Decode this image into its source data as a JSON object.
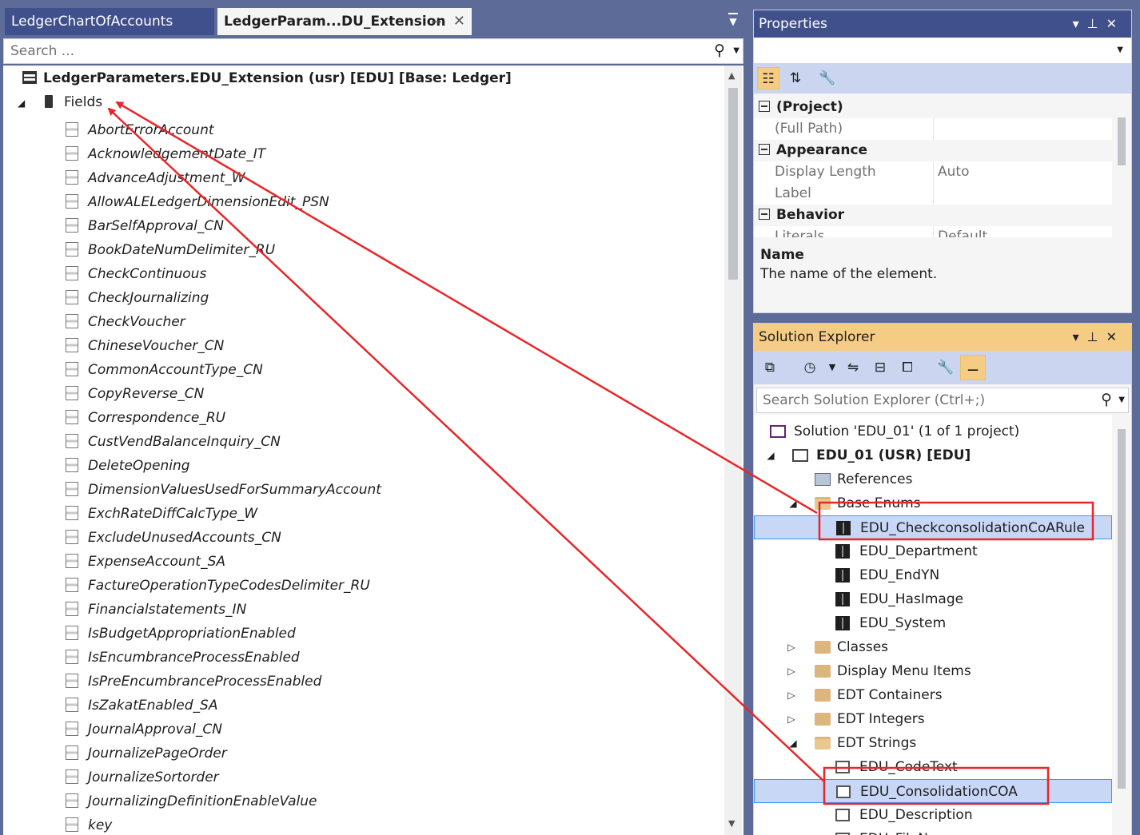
{
  "editor": {
    "tabs": [
      {
        "label": "LedgerChartOfAccounts",
        "active": false
      },
      {
        "label": "LedgerParam...DU_Extension",
        "active": true
      }
    ],
    "search_placeholder": "Search ...",
    "root_label": "LedgerParameters.EDU_Extension (usr) [EDU] [Base: Ledger]",
    "fields_label": "Fields",
    "fields": [
      "AbortErrorAccount",
      "AcknowledgementDate_IT",
      "AdvanceAdjustment_W",
      "AllowALELedgerDimensionEdit_PSN",
      "BarSelfApproval_CN",
      "BookDateNumDelimiter_RU",
      "CheckContinuous",
      "CheckJournalizing",
      "CheckVoucher",
      "ChineseVoucher_CN",
      "CommonAccountType_CN",
      "CopyReverse_CN",
      "Correspondence_RU",
      "CustVendBalanceInquiry_CN",
      "DeleteOpening",
      "DimensionValuesUsedForSummaryAccount",
      "ExchRateDiffCalcType_W",
      "ExcludeUnusedAccounts_CN",
      "ExpenseAccount_SA",
      "FactureOperationTypeCodesDelimiter_RU",
      "Financialstatements_IN",
      "IsBudgetAppropriationEnabled",
      "IsEncumbranceProcessEnabled",
      "IsPreEncumbranceProcessEnabled",
      "IsZakatEnabled_SA",
      "JournalApproval_CN",
      "JournalizePageOrder",
      "JournalizeSortorder",
      "JournalizingDefinitionEnableValue",
      "key"
    ]
  },
  "properties": {
    "title": "Properties",
    "categories": [
      {
        "name": "(Project)",
        "rows": [
          {
            "name": "(Full Path)",
            "value": ""
          }
        ]
      },
      {
        "name": "Appearance",
        "rows": [
          {
            "name": "Display Length",
            "value": "Auto"
          },
          {
            "name": "Label",
            "value": ""
          }
        ]
      },
      {
        "name": "Behavior",
        "rows": [
          {
            "name": "Literals",
            "value": "Default"
          }
        ]
      }
    ],
    "description_name": "Name",
    "description_text": "The name of the element."
  },
  "solution_explorer": {
    "title": "Solution Explorer",
    "search_placeholder": "Search Solution Explorer (Ctrl+;)",
    "solution_label": "Solution 'EDU_01' (1 of 1 project)",
    "project_label": "EDU_01 (USR) [EDU]",
    "references_label": "References",
    "base_enums_label": "Base Enums",
    "base_enums": [
      "EDU_CheckconsolidationCoARule",
      "EDU_Department",
      "EDU_EndYN",
      "EDU_HasImage",
      "EDU_System"
    ],
    "folders_collapsed": [
      "Classes",
      "Display Menu Items",
      "EDT Containers",
      "EDT Integers"
    ],
    "edt_strings_label": "EDT Strings",
    "edt_strings": [
      "EDU_CodeText",
      "EDU_ConsolidationCOA",
      "EDU_Description",
      "EDU_FileName"
    ]
  },
  "annotation_color": "#e8262b",
  "selection_color": "#c9d7f7",
  "accent_active_title": "#f5cc84"
}
